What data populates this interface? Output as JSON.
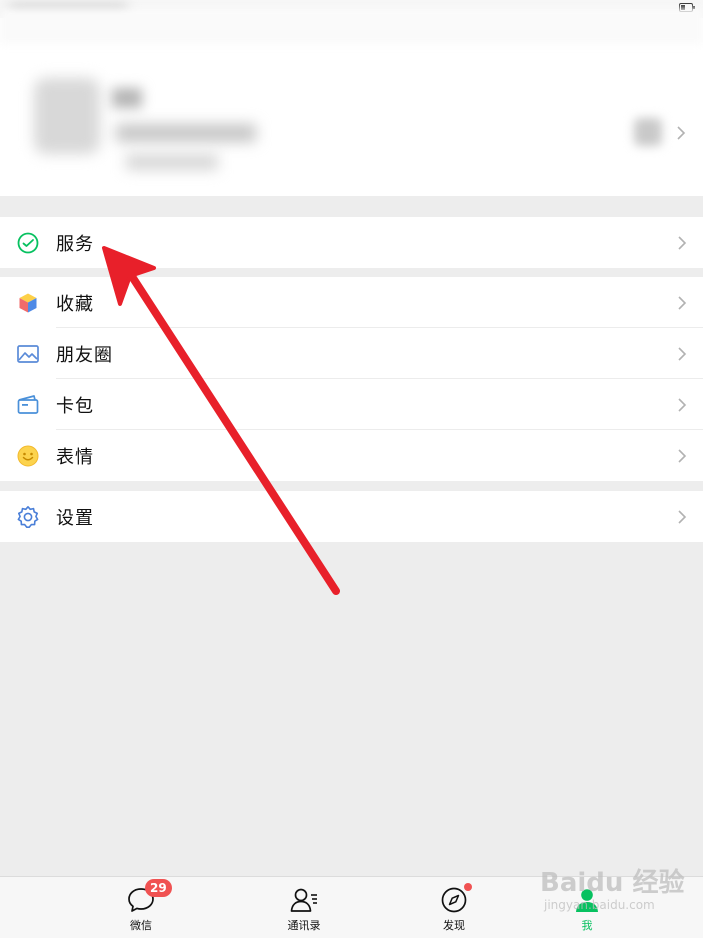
{
  "status_bar": {
    "battery": "battery-icon"
  },
  "profile": {
    "chevron": "chevron-right-icon"
  },
  "menu": {
    "group1": [
      {
        "label": "服务",
        "icon": "service-icon",
        "color": "#07c160"
      }
    ],
    "group2": [
      {
        "label": "收藏",
        "icon": "favorites-icon",
        "color": "#5d8ce4"
      },
      {
        "label": "朋友圈",
        "icon": "moments-icon",
        "color": "#5a8bd8"
      },
      {
        "label": "卡包",
        "icon": "cards-icon",
        "color": "#4a90d9"
      },
      {
        "label": "表情",
        "icon": "sticker-icon",
        "color": "#f5c242"
      }
    ],
    "group3": [
      {
        "label": "设置",
        "icon": "settings-icon",
        "color": "#4a7fd8"
      }
    ]
  },
  "tabbar": {
    "tabs": [
      {
        "label": "微信",
        "icon": "chat-icon",
        "badge": "29"
      },
      {
        "label": "通讯录",
        "icon": "contacts-icon"
      },
      {
        "label": "发现",
        "icon": "discover-icon"
      },
      {
        "label": "我",
        "icon": "me-icon",
        "active": true
      }
    ],
    "active_color": "#07c160"
  },
  "watermark": {
    "main": "Baidu 经验",
    "sub": "jingyan.baidu.com"
  },
  "annotation": {
    "arrow_color": "#e8202a"
  }
}
